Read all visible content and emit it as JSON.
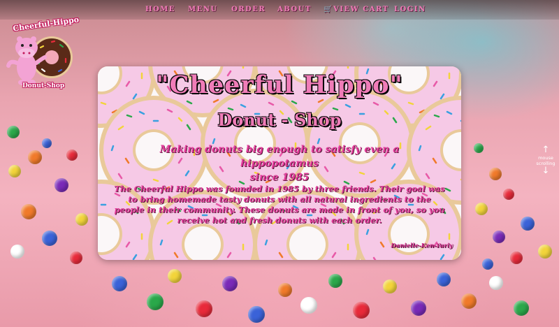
{
  "nav": {
    "items": [
      {
        "label": "HOME"
      },
      {
        "label": "MENU"
      },
      {
        "label": "ORDER"
      },
      {
        "label": "ABOUT"
      },
      {
        "label": "🛒VIEW CART"
      },
      {
        "label": "LOGIN"
      }
    ]
  },
  "logo": {
    "top_text": "Cheerful-Hippo",
    "bottom_text": "Donut-Shop"
  },
  "card": {
    "title": "\"Cheerful   Hippo\"",
    "subtitle": "Donut - Shop",
    "tagline_line1": "Making donuts big enough to satisfy even a hippopotamus",
    "tagline_line2": "since 1985",
    "about": "The Cheerful Hippo was founded in 1985 by three friends. Their goal was to bring homemade tasty donuts with all natural ingredients to the people in their community. These donuts are made in front of you, so you receive hot and fresh donuts with each order.",
    "signature": "Danielle-Ken-Yuriy"
  },
  "scroll_hint": {
    "up_arrow": "↑",
    "label_line1": "mouse",
    "label_line2": "scrolling",
    "down_arrow": "↓"
  },
  "colors": {
    "brand_pink": "#f07cb8",
    "text_magenta": "#e23a9a",
    "card_bg": "#fbf7f8",
    "donut_icing": "#f6c9e6",
    "donut_dough": "#e9c99a"
  }
}
